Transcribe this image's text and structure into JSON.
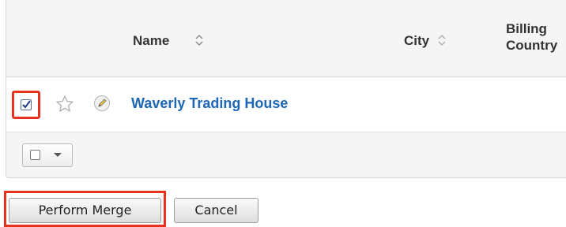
{
  "table": {
    "columns": [
      {
        "label": "Name",
        "sortable": true
      },
      {
        "label": "City",
        "sortable": true
      },
      {
        "label": "Billing Country",
        "sortable": false
      }
    ],
    "billing_line1": "Billing",
    "billing_line2": "Country",
    "rows": [
      {
        "name": "Waverly Trading House",
        "checked": true,
        "favorite": false
      }
    ]
  },
  "actions": {
    "perform_merge": "Perform Merge",
    "cancel": "Cancel"
  },
  "colors": {
    "highlight": "#e8321e",
    "link": "#1c66b8",
    "header_bg": "#f5f5f5"
  },
  "icons": [
    "star-icon",
    "edit-pencil-icon",
    "sort-icon",
    "checkbox-icon",
    "caret-down-icon"
  ]
}
